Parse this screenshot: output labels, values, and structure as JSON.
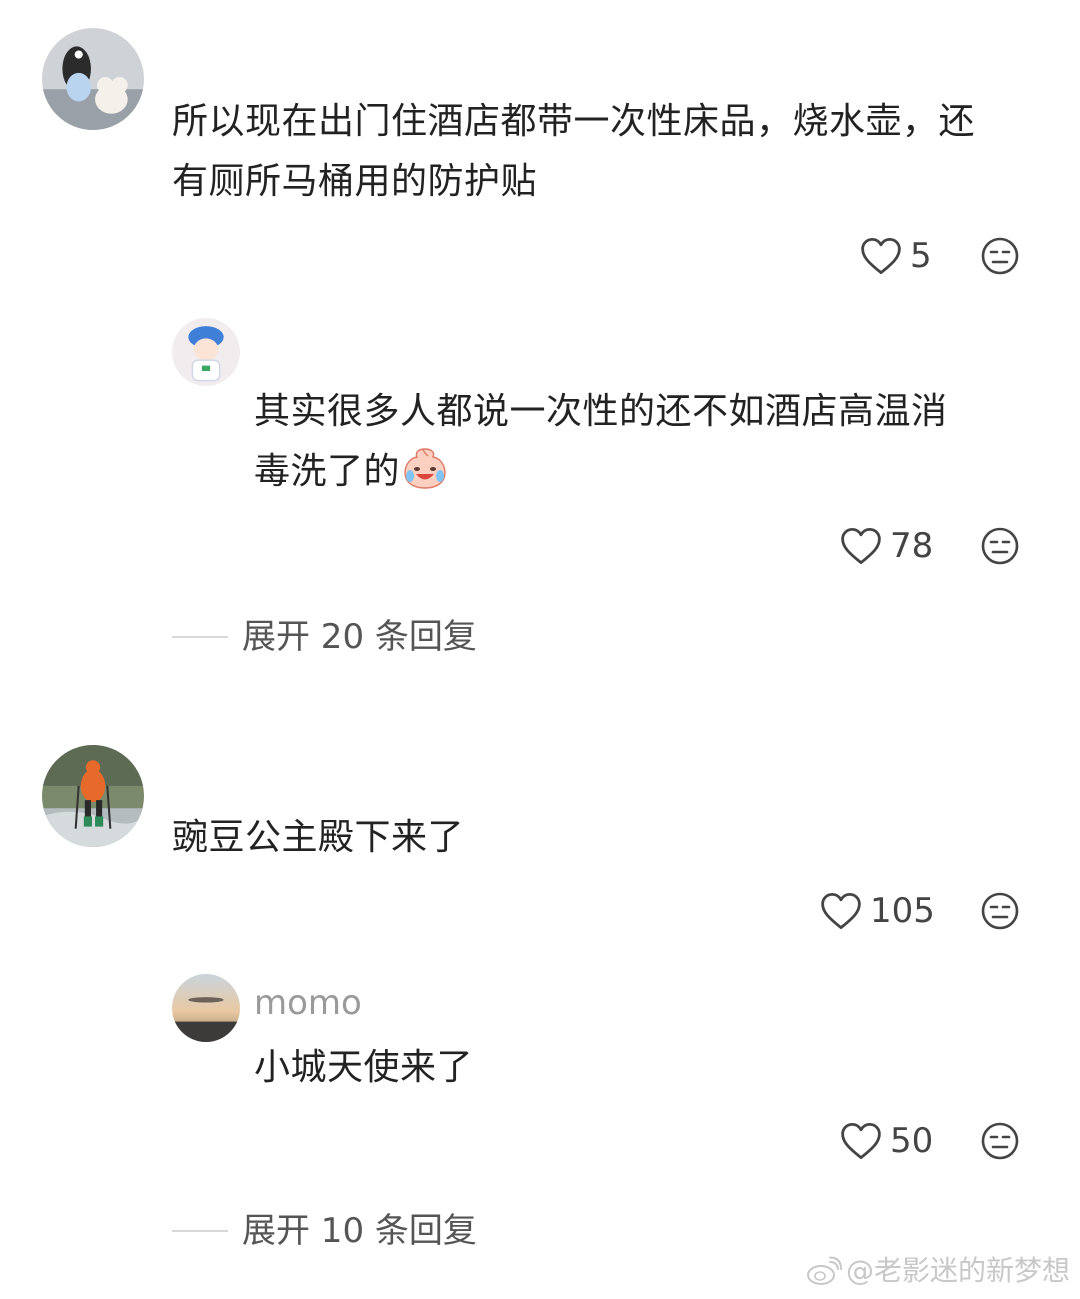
{
  "comments": [
    {
      "text_lines": [
        "所以现在出门住酒店都带一次性床品，烧水壶，还",
        "有厕所马桶用的防护贴"
      ],
      "likes": "5",
      "reply": {
        "username": "",
        "text_lines": [
          "其实很多人都说一次性的还不如酒店高温消",
          "毒洗了的"
        ],
        "likes": "78"
      },
      "expand_label": "展开 20 条回复"
    },
    {
      "text_lines": [
        "豌豆公主殿下来了"
      ],
      "likes": "105",
      "reply": {
        "username": "momo",
        "text_lines": [
          "小城天使来了"
        ],
        "likes": "50"
      },
      "expand_label": "展开 10 条回复"
    }
  ],
  "watermark": "@老影迷的新梦想",
  "icons": {
    "like": "heart-outline-icon",
    "react": "meh-face-icon",
    "emoji": "crying-laughing-peach-emoji",
    "watermark": "weibo-logo-icon"
  }
}
